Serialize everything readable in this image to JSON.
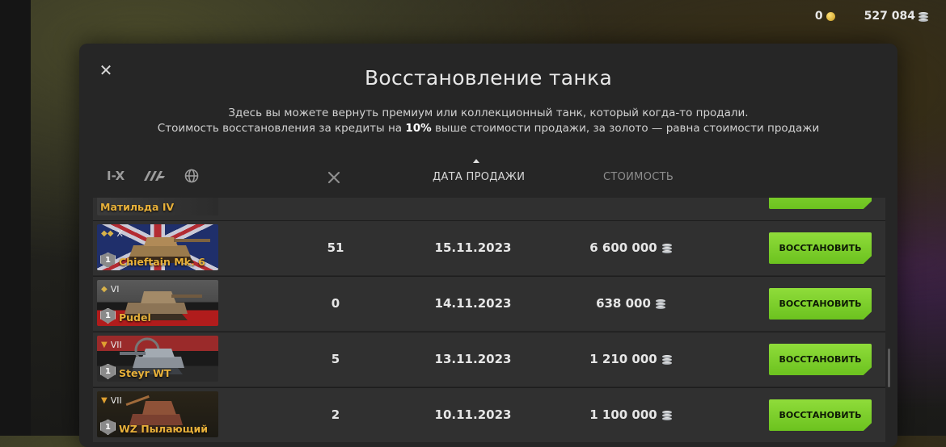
{
  "topbar": {
    "gold": "0",
    "credits": "527 084"
  },
  "modal": {
    "title": "Восстановление танка",
    "subtitle_line1": "Здесь вы можете вернуть премиум или коллекционный танк, который когда-то продали.",
    "subtitle_line2_a": "Стоимость восстановления за кредиты на ",
    "subtitle_line2_b": "10%",
    "subtitle_line2_c": " выше стоимости продажи, за золото — равна стоимости продажи"
  },
  "filters": {
    "tier_label": "I-X"
  },
  "columns": {
    "date": "ДАТА ПРОДАЖИ",
    "cost": "СТОИМОСТЬ"
  },
  "restore_label": "ВОССТАНОВИТЬ",
  "rows": [
    {
      "name": "Матильда IV",
      "tier": "",
      "battles": "",
      "date": "",
      "cost": ""
    },
    {
      "name": "Chieftain Mk. 6",
      "tier": "X",
      "battles": "51",
      "date": "15.11.2023",
      "cost": "6 600 000"
    },
    {
      "name": "Pudel",
      "tier": "VI",
      "battles": "0",
      "date": "14.11.2023",
      "cost": "638 000"
    },
    {
      "name": "Steyr WT",
      "tier": "VII",
      "battles": "5",
      "date": "13.11.2023",
      "cost": "1 210 000"
    },
    {
      "name": "WZ Пылающий",
      "tier": "VII",
      "battles": "2",
      "date": "10.11.2023",
      "cost": "1 100 000"
    }
  ],
  "colors": {
    "accent_green": "#7fd22c",
    "tank_name": "#e8b13a",
    "panel": "#262626"
  }
}
